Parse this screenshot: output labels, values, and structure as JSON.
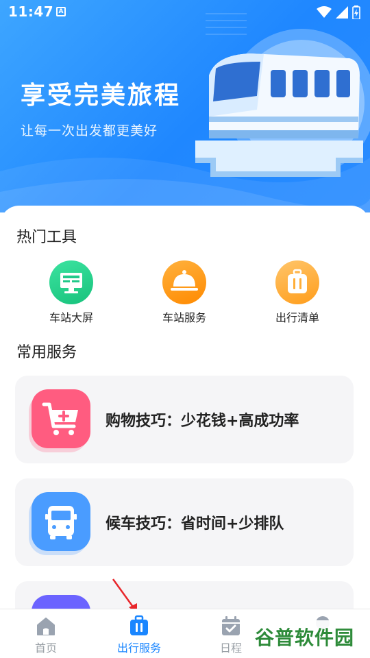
{
  "status": {
    "time": "11:47",
    "notification_letter": "A"
  },
  "hero": {
    "title": "享受完美旅程",
    "subtitle": "让每一次出发都更美好"
  },
  "hot_tools": {
    "title": "热门工具",
    "items": [
      {
        "label": "车站大屏",
        "icon": "monitor-icon",
        "color": "#21c98a"
      },
      {
        "label": "车站服务",
        "icon": "service-bell-icon",
        "color": "#ff9a12"
      },
      {
        "label": "出行清单",
        "icon": "suitcase-icon",
        "color": "#ffae38"
      }
    ]
  },
  "common_services": {
    "title": "常用服务",
    "items": [
      {
        "label": "购物技巧：少花钱+高成功率",
        "icon": "shopping-cart-icon",
        "color": "#ff5c80"
      },
      {
        "label": "候车技巧：省时间+少排队",
        "icon": "bus-icon",
        "color": "#4a9cff"
      },
      {
        "label": "",
        "icon": "service-icon",
        "color": "#6b63ff"
      }
    ]
  },
  "tabbar": {
    "items": [
      {
        "label": "首页",
        "icon": "home-icon",
        "active": false
      },
      {
        "label": "出行服务",
        "icon": "suitcase-icon",
        "active": true
      },
      {
        "label": "日程",
        "icon": "calendar-icon",
        "active": false
      },
      {
        "label": "",
        "icon": "profile-icon",
        "active": false
      }
    ]
  },
  "watermark": {
    "text": "谷普软件园"
  },
  "colors": {
    "brand": "#1a86ff",
    "hero_start": "#3ea6ff",
    "hero_end": "#1f87ff",
    "annotation_arrow": "#e8262b"
  }
}
